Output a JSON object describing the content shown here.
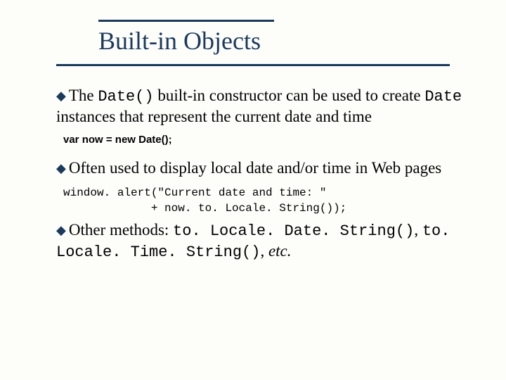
{
  "title": "Built-in Objects",
  "bullets": {
    "b1": {
      "pre": "The ",
      "code1": "Date()",
      "mid": " built-in constructor can be used to create ",
      "code2": "Date",
      "post": " instances that represent the current date and time"
    },
    "code1": "var now = new Date();",
    "b2": "Often used to display local date and/or time in Web pages",
    "code2a": "window. alert(\"Current date and time: \"",
    "code2b": "             + now. to. Locale. String());",
    "b3": {
      "pre": "Other methods: ",
      "code1": "to. Locale. Date. String()",
      "comma": ", ",
      "code2": "to. Locale. Time. String()",
      "comma2": ", ",
      "etc": "etc."
    }
  }
}
